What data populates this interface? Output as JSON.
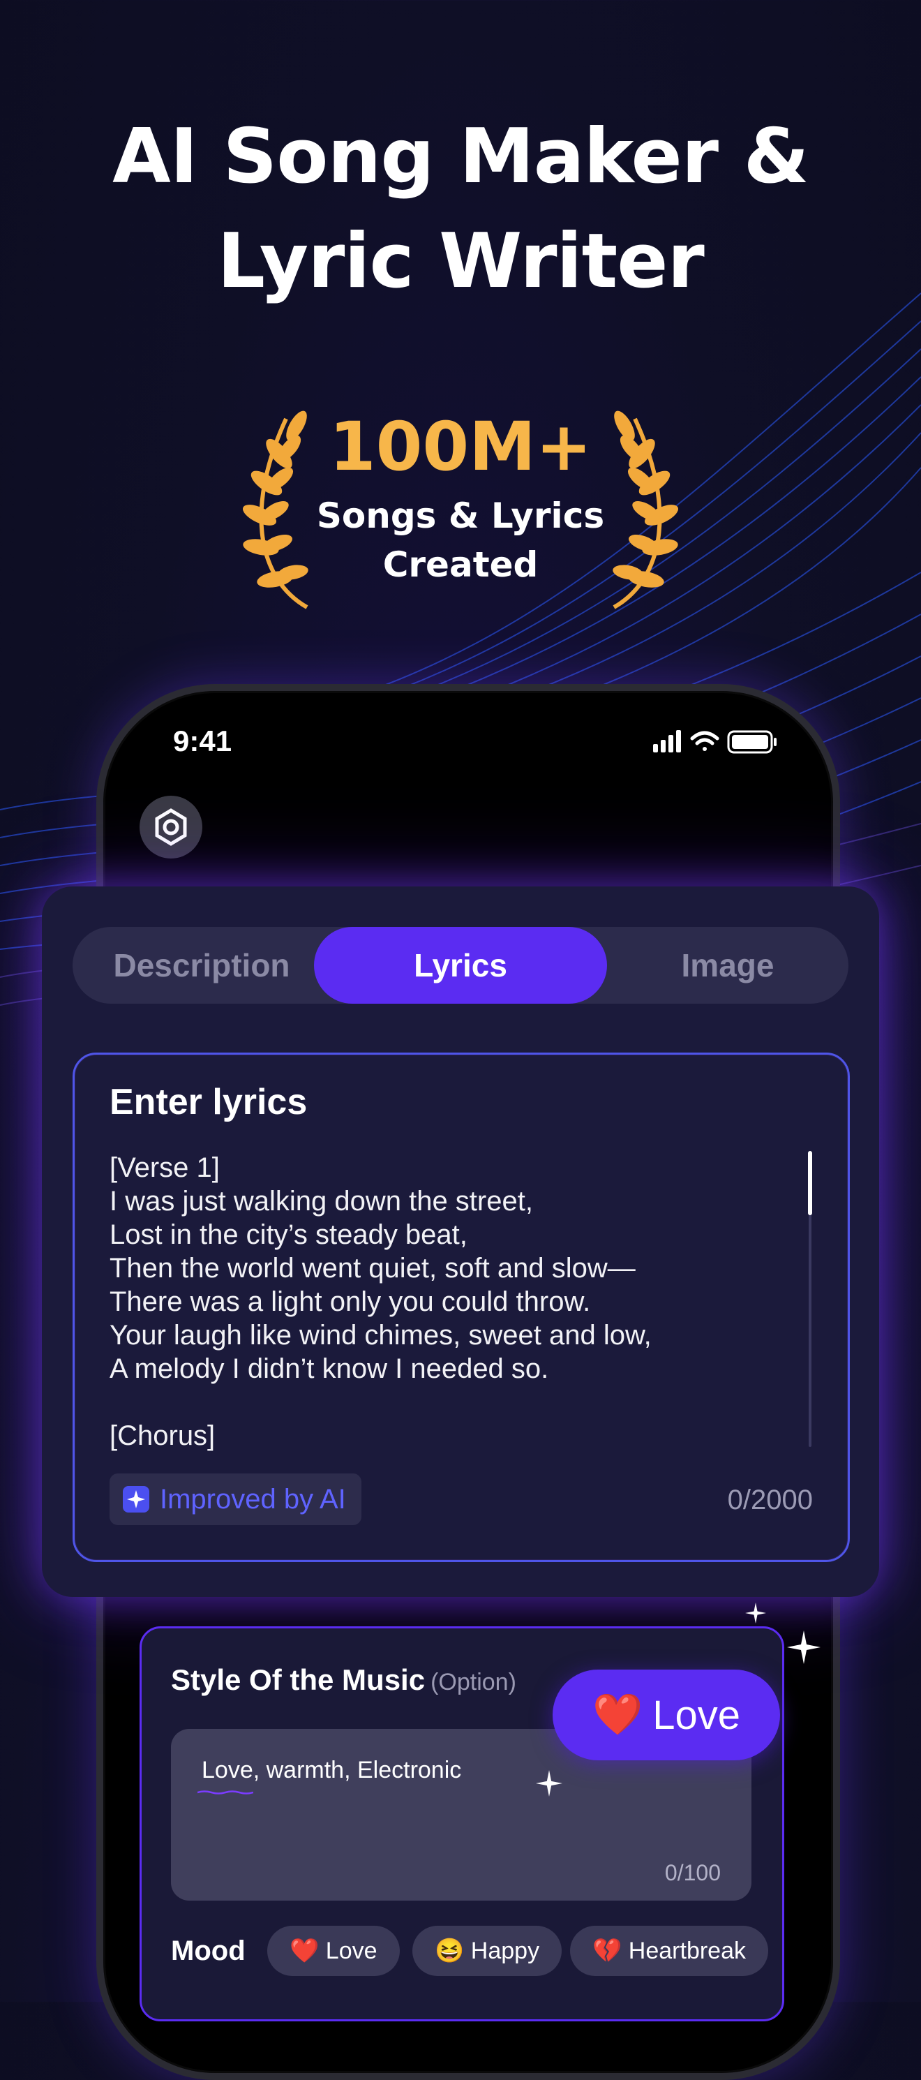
{
  "headline": {
    "line1": "AI Song Maker &",
    "line2": "Lyric Writer"
  },
  "award": {
    "count": "100M+",
    "line1": "Songs & Lyrics",
    "line2": "Created"
  },
  "status": {
    "time": "9:41"
  },
  "tabs": [
    {
      "label": "Description"
    },
    {
      "label": "Lyrics"
    },
    {
      "label": "Image"
    }
  ],
  "lyrics": {
    "title": "Enter lyrics",
    "text": "[Verse 1]\nI was just walking down the street,\nLost in the city’s steady beat,\nThen the world went quiet, soft and slow—\nThere was a light only you could throw.\nYour laugh like wind chimes, sweet and low,\nA melody I didn’t know I needed so.\n\n[Chorus]",
    "ai_label": "Improved by AI",
    "counter": "0/2000"
  },
  "style": {
    "title": "Style Of the Music",
    "option": "(Option)",
    "value": "Love, warmth, Electronic",
    "counter": "0/100"
  },
  "mood": {
    "label": "Mood",
    "chips": [
      {
        "emoji": "❤️",
        "label": "Love"
      },
      {
        "emoji": "😆",
        "label": "Happy"
      },
      {
        "emoji": "💔",
        "label": "Heartbreak"
      }
    ]
  },
  "floating_tag": {
    "emoji": "❤️",
    "label": "Love"
  },
  "colors": {
    "accent": "#5b2cf2",
    "gold": "#f7b64a",
    "ai_blue": "#5f63ff"
  },
  "icons": [
    "laurel-icon",
    "signal-icon",
    "wifi-icon",
    "battery-icon",
    "app-logo-icon",
    "sparkle-ai-icon",
    "sparkle-star-icon"
  ]
}
